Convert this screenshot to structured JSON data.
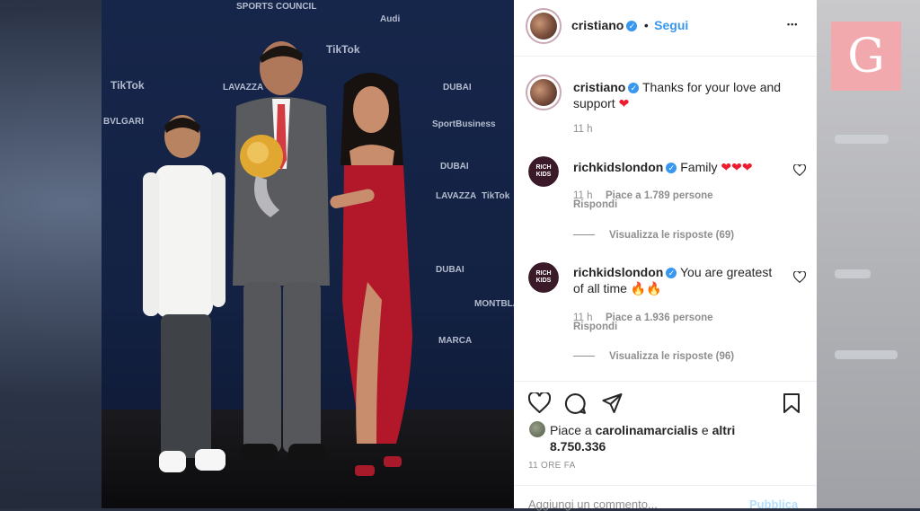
{
  "background": {
    "accent_logo_letter": "G",
    "accent_logo_color": "#f1a9ad"
  },
  "photo": {
    "sponsor_logos": [
      "SPORTS COUNCIL",
      "Audi",
      "TikTok",
      "LAVAZZA",
      "DUBAI",
      "BVLGARI",
      "SportBusiness",
      "MARCA",
      "MONTBLANC",
      "TikTok",
      "DUBAI",
      "TikTok",
      "LAVAZZA",
      "DUBAI"
    ]
  },
  "post": {
    "header": {
      "username": "cristiano",
      "separator": "•",
      "follow_label": "Segui",
      "more_label": "•••"
    },
    "caption": {
      "username": "cristiano",
      "text": "Thanks for your love and support",
      "emoji": "❤",
      "time": "11 h"
    },
    "comments": [
      {
        "username": "richkidslondon",
        "text": "Family",
        "emoji": "❤❤❤",
        "time": "11 h",
        "likes": "Piace a 1.789 persone",
        "reply": "Rispondi",
        "view_replies": "Visualizza le risposte (69)"
      },
      {
        "username": "richkidslondon",
        "text": "You are greatest of all time",
        "emoji": "🔥🔥",
        "time": "11 h",
        "likes": "Piace a 1.936 persone",
        "reply": "Rispondi",
        "view_replies": "Visualizza le risposte (96)"
      }
    ],
    "likes_line": {
      "prefix": "Piace a",
      "liker": "carolinamarcialis",
      "suffix": "e",
      "others": "altri 8.750.336"
    },
    "timestamp": "11 ORE FA",
    "comment_placeholder": "Aggiungi un commento...",
    "publish_label": "Pubblica",
    "avatar_rkl_text": "RICH KIDS"
  },
  "colors": {
    "link_blue": "#3897f0",
    "muted": "#8e8e8e",
    "text": "#262626",
    "heart": "#ed1c2e"
  }
}
